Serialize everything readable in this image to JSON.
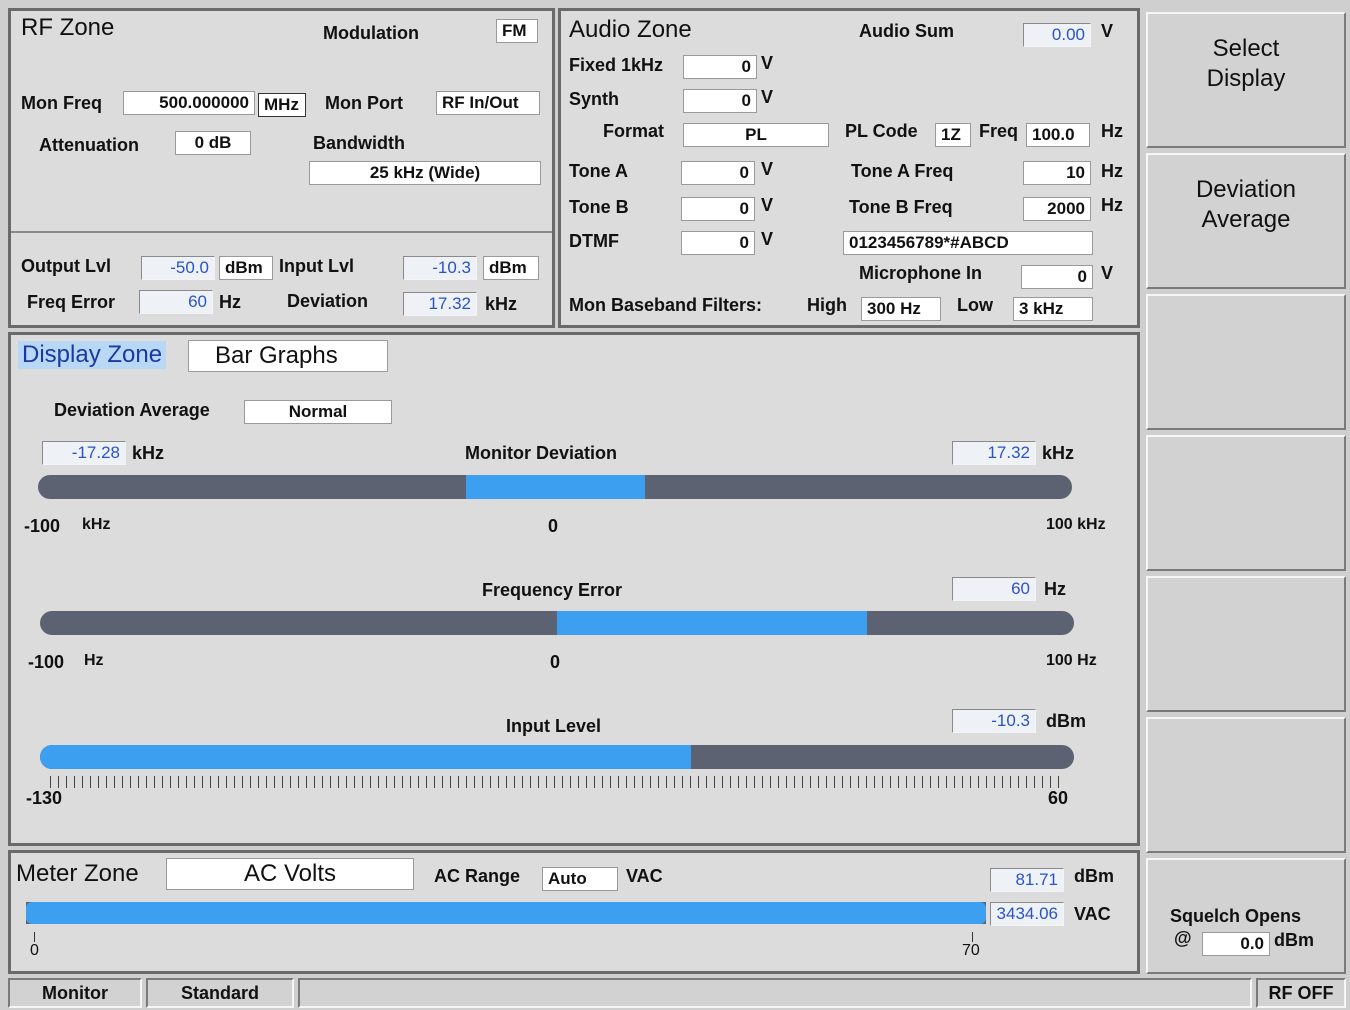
{
  "rf": {
    "title": "RF Zone",
    "modulation_label": "Modulation",
    "modulation": "FM",
    "mon_freq_label": "Mon Freq",
    "mon_freq": "500.000000",
    "mon_freq_unit": "MHz",
    "mon_port_label": "Mon Port",
    "mon_port": "RF In/Out",
    "attenuation_label": "Attenuation",
    "attenuation": "0 dB",
    "bandwidth_label": "Bandwidth",
    "bandwidth": "25 kHz (Wide)",
    "output_lvl_label": "Output Lvl",
    "output_lvl": "-50.0",
    "output_unit": "dBm",
    "input_lvl_label": "Input Lvl",
    "input_lvl": "-10.3",
    "input_unit": "dBm",
    "freq_error_label": "Freq Error",
    "freq_error": "60",
    "freq_error_unit": "Hz",
    "deviation_label": "Deviation",
    "deviation": "17.32",
    "deviation_unit": "kHz"
  },
  "audio": {
    "title": "Audio Zone",
    "sum_label": "Audio Sum",
    "sum": "0.00",
    "sum_unit": "V",
    "fixed_label": "Fixed 1kHz",
    "fixed": "0",
    "fixed_unit": "V",
    "synth_label": "Synth",
    "synth": "0",
    "synth_unit": "V",
    "format_label": "Format",
    "format": "PL",
    "pl_code_label": "PL Code",
    "pl_code": "1Z",
    "freq_label": "Freq",
    "freq": "100.0",
    "freq_unit": "Hz",
    "tone_a_label": "Tone A",
    "tone_a": "0",
    "tone_a_unit": "V",
    "tone_a_freq_label": "Tone A Freq",
    "tone_a_freq": "10",
    "tone_a_freq_unit": "Hz",
    "tone_b_label": "Tone B",
    "tone_b": "0",
    "tone_b_unit": "V",
    "tone_b_freq_label": "Tone B Freq",
    "tone_b_freq": "2000",
    "tone_b_freq_unit": "Hz",
    "dtmf_label": "DTMF",
    "dtmf": "0",
    "dtmf_unit": "V",
    "dtmf_string": "0123456789*#ABCD",
    "mic_label": "Microphone In",
    "mic": "0",
    "mic_unit": "V",
    "filters_label": "Mon Baseband Filters:",
    "high_label": "High",
    "high": "300 Hz",
    "low_label": "Low",
    "low": "3 kHz"
  },
  "display": {
    "title": "Display Zone",
    "mode": "Bar Graphs",
    "dev_avg_label": "Deviation Average",
    "dev_avg": "Normal",
    "monitor_deviation": {
      "title": "Monitor Deviation",
      "neg_value": "-17.28",
      "neg_unit": "kHz",
      "pos_value": "17.32",
      "pos_unit": "kHz",
      "min_label": "-100",
      "min_unit": "kHz",
      "zero_label": "0",
      "max_label": "100 kHz",
      "min": -100,
      "max": 100,
      "fill_from": -17.28,
      "fill_to": 17.32
    },
    "frequency_error": {
      "title": "Frequency Error",
      "value": "60",
      "unit": "Hz",
      "min_label": "-100",
      "min_unit": "Hz",
      "zero_label": "0",
      "max_label": "100 Hz",
      "min": -100,
      "max": 100,
      "fill_from": 0,
      "fill_to": 60
    },
    "input_level": {
      "title": "Input Level",
      "value": "-10.3",
      "unit": "dBm",
      "min_label": "-130",
      "max_label": "60",
      "min": -130,
      "max": 60,
      "fill_from": -130,
      "fill_to": -10.3
    }
  },
  "meter": {
    "title": "Meter Zone",
    "mode": "AC Volts",
    "range_label": "AC Range",
    "range": "Auto",
    "range_unit": "VAC",
    "dbm": "81.71",
    "dbm_unit": "dBm",
    "vac": "3434.06",
    "vac_unit": "VAC",
    "scale_min": "0",
    "scale_max": "70",
    "fill_fraction": 1.0
  },
  "softkeys": {
    "select_display_1": "Select",
    "select_display_2": "Display",
    "deviation_average_1": "Deviation",
    "deviation_average_2": "Average",
    "squelch_label": "Squelch Opens",
    "squelch_at": "@",
    "squelch_value": "0.0",
    "squelch_unit": "dBm"
  },
  "status": {
    "monitor": "Monitor",
    "standard": "Standard",
    "rf": "RF OFF"
  },
  "colors": {
    "bar_fill": "#3d9ff0",
    "bar_track": "#5c6272",
    "value_text": "#2a54c8"
  }
}
